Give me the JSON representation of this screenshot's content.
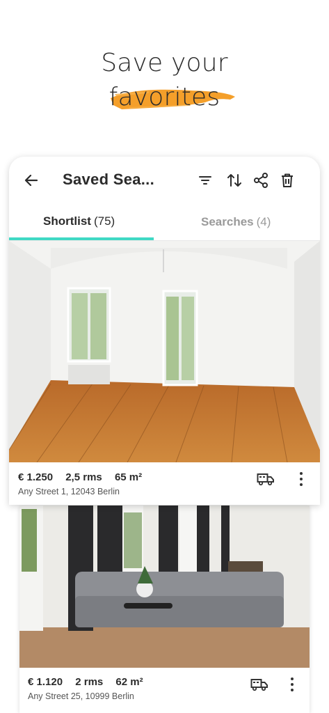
{
  "promo": {
    "line1": "Save your",
    "line2": "favorites",
    "accent": "#f39a1f"
  },
  "appbar": {
    "title": "Saved Sea...",
    "icons": [
      "back-arrow-icon",
      "filter-icon",
      "sort-icon",
      "share-icon",
      "trash-icon"
    ]
  },
  "tabs": [
    {
      "label": "Shortlist",
      "count": "(75)",
      "active": true
    },
    {
      "label": "Searches",
      "count": "(4)",
      "active": false
    }
  ],
  "colors": {
    "tab_indicator": "#3fd9c4",
    "text": "#2b2b2b",
    "muted": "#9a9a9a"
  },
  "listings": [
    {
      "price": "€ 1.250",
      "rooms": "2,5 rms",
      "area": "65 m²",
      "address": "Any Street 1, 12043 Berlin",
      "icons": [
        "moving-truck-icon",
        "more-vertical-icon"
      ]
    },
    {
      "price": "€ 1.120",
      "rooms": "2 rms",
      "area": "62 m²",
      "address": "Any Street 25, 10999 Berlin",
      "icons": [
        "moving-truck-icon",
        "more-vertical-icon"
      ]
    }
  ]
}
